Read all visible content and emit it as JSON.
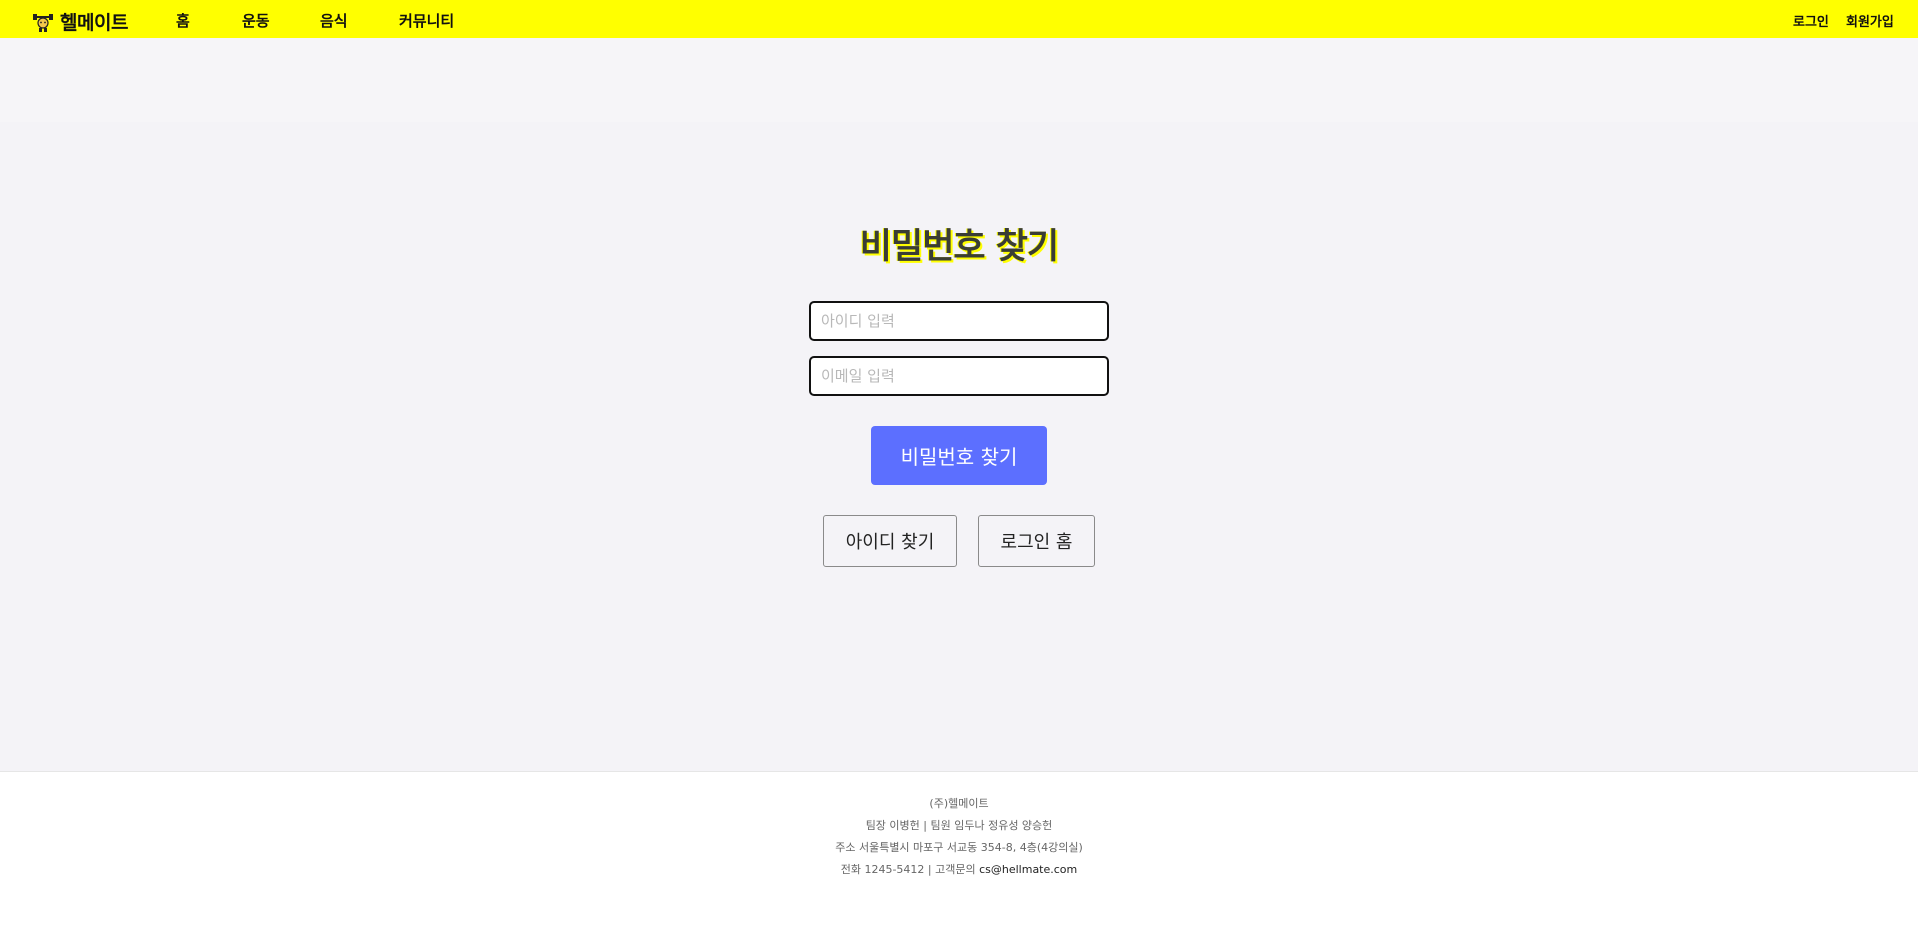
{
  "header": {
    "brand": {
      "icon": "dumbbell-mascot-icon",
      "name": "헬메이트"
    },
    "nav": [
      "홈",
      "운동",
      "음식",
      "커뮤니티"
    ],
    "auth": {
      "login": "로그인",
      "signup": "회원가입"
    },
    "bg_color": "#ffff00"
  },
  "main": {
    "title": "비밀번호 찾기",
    "id_placeholder": "아이디 입력",
    "email_placeholder": "이메일 입력",
    "submit_label": "비밀번호 찾기",
    "find_id_label": "아이디 찾기",
    "login_home_label": "로그인 홈",
    "accent_color": "#5c6fff"
  },
  "footer": {
    "company": "(주)헬메이트",
    "team": "팀장 이병헌 | 팀원 임두나 정유성 양승헌",
    "address": "주소 서울특별시 마포구 서교동 354-8, 4층(4강의실)",
    "contact_prefix": "전화 1245-5412 | 고객문의 ",
    "email": "cs@hellmate.com"
  }
}
